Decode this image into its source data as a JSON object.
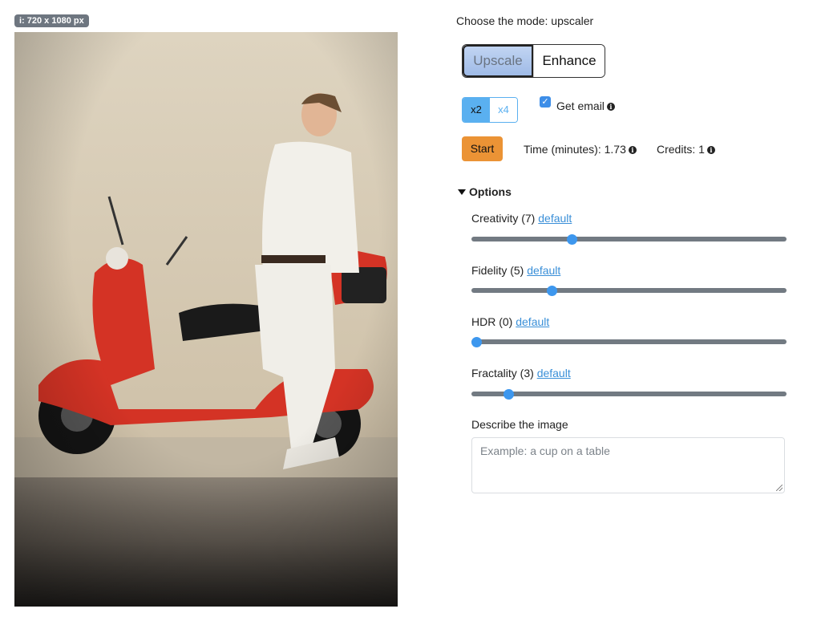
{
  "image": {
    "badge": "i: 720 x 1080 px"
  },
  "mode": {
    "label": "Choose the mode: upscaler",
    "options": [
      "Upscale",
      "Enhance"
    ],
    "selected": "Upscale"
  },
  "scale": {
    "options": [
      "x2",
      "x4"
    ],
    "selected": "x2"
  },
  "email": {
    "label": "Get email",
    "checked": true
  },
  "start": {
    "label": "Start"
  },
  "time": {
    "label": "Time (minutes): 1.73"
  },
  "credits": {
    "label": "Credits: 1"
  },
  "options": {
    "title": "Options",
    "default_link": "default",
    "sliders": [
      {
        "label": "Creativity (7)",
        "value": 7
      },
      {
        "label": "Fidelity (5)",
        "value": 5
      },
      {
        "label": "HDR (0)",
        "value": 0
      },
      {
        "label": "Fractality (3)",
        "value": 3
      }
    ]
  },
  "describe": {
    "label": "Describe the image",
    "placeholder": "Example: a cup on a table"
  },
  "colors": {
    "accent": "#3d97ee",
    "start": "#eb9335",
    "toggle": "#5ab0f0"
  }
}
